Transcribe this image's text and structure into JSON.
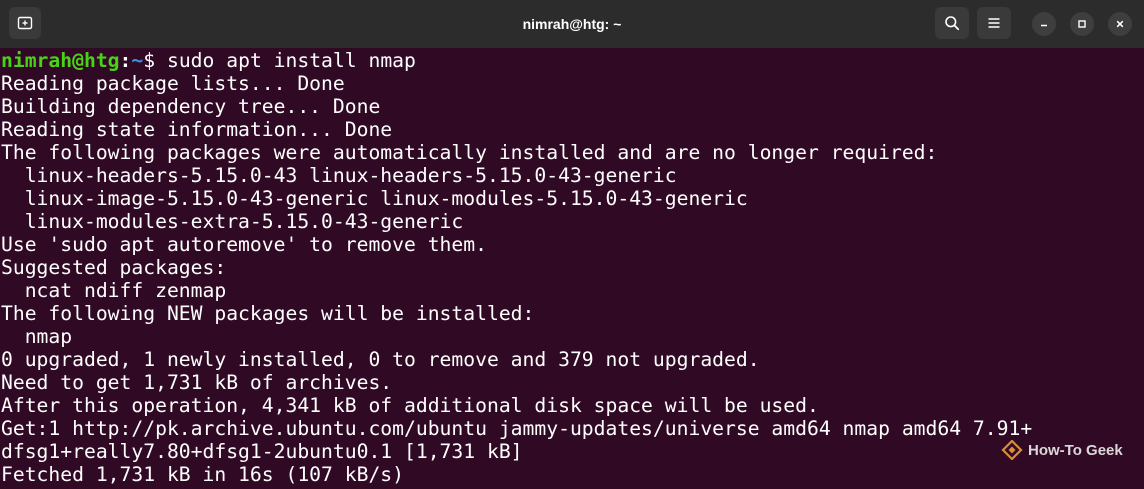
{
  "window": {
    "title": "nimrah@htg: ~"
  },
  "prompt": {
    "user_host": "nimrah@htg",
    "separator": ":",
    "path": "~",
    "symbol": "$ ",
    "command": "sudo apt install nmap"
  },
  "output": [
    "Reading package lists... Done",
    "Building dependency tree... Done",
    "Reading state information... Done",
    "The following packages were automatically installed and are no longer required:",
    "  linux-headers-5.15.0-43 linux-headers-5.15.0-43-generic",
    "  linux-image-5.15.0-43-generic linux-modules-5.15.0-43-generic",
    "  linux-modules-extra-5.15.0-43-generic",
    "Use 'sudo apt autoremove' to remove them.",
    "Suggested packages:",
    "  ncat ndiff zenmap",
    "The following NEW packages will be installed:",
    "  nmap",
    "0 upgraded, 1 newly installed, 0 to remove and 379 not upgraded.",
    "Need to get 1,731 kB of archives.",
    "After this operation, 4,341 kB of additional disk space will be used.",
    "Get:1 http://pk.archive.ubuntu.com/ubuntu jammy-updates/universe amd64 nmap amd64 7.91+",
    "dfsg1+really7.80+dfsg1-2ubuntu0.1 [1,731 kB]",
    "Fetched 1,731 kB in 16s (107 kB/s)"
  ],
  "watermark": {
    "text": "How-To Geek",
    "icon": "how-to-geek-logo-icon"
  },
  "icons": {
    "new_tab": "new-tab-icon",
    "search": "search-icon",
    "menu": "hamburger-menu-icon",
    "minimize": "minimize-icon",
    "maximize": "maximize-icon",
    "close": "close-icon"
  },
  "colors": {
    "terminal_bg": "#300a24",
    "titlebar_bg": "#2c2c2c",
    "prompt_user": "#4ad219",
    "prompt_path": "#3d8fe0",
    "text": "#ffffff"
  }
}
